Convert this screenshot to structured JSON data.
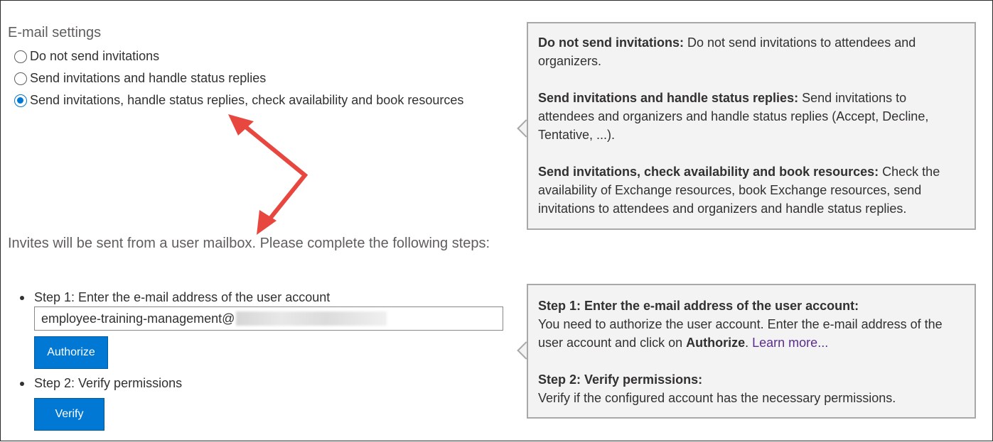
{
  "email_settings": {
    "title": "E-mail settings",
    "options": [
      {
        "label": "Do not send invitations",
        "selected": false
      },
      {
        "label": "Send invitations and handle status replies",
        "selected": false
      },
      {
        "label": "Send invitations, handle status replies, check availability and book resources",
        "selected": true
      }
    ]
  },
  "help_invitations": {
    "items": [
      {
        "term": "Do not send invitations:",
        "desc": " Do not send invitations to attendees and organizers."
      },
      {
        "term": "Send invitations and handle status replies:",
        "desc": " Send invitations to attendees and organizers and handle status replies (Accept, Decline, Tentative, ...)."
      },
      {
        "term": "Send invitations, check availability and book resources:",
        "desc": " Check the availability of Exchange resources, book Exchange resources, send invitations to attendees and organizers and handle status replies."
      }
    ]
  },
  "mailbox_info": "Invites will be sent from a user mailbox. Please complete the following steps:",
  "steps": {
    "step1_label": "Step 1: Enter the e-mail address of the user account",
    "email_value": "employee-training-management@",
    "authorize_label": "Authorize",
    "step2_label": "Step 2: Verify permissions",
    "verify_label": "Verify"
  },
  "help_steps": {
    "step1_term": "Step 1: Enter the e-mail address of the user account:",
    "step1_desc_a": "You need to authorize the user account. Enter the e-mail address of the user account and click on ",
    "step1_desc_bold": "Authorize",
    "step1_desc_b": ". ",
    "learn_more": "Learn more...",
    "step2_term": "Step 2: Verify permissions:",
    "step2_desc": "Verify if the configured account has the necessary permissions."
  },
  "colors": {
    "accent": "#0078d4",
    "annotation_arrow": "#e8473f",
    "callout_bg": "#f3f3f3"
  }
}
